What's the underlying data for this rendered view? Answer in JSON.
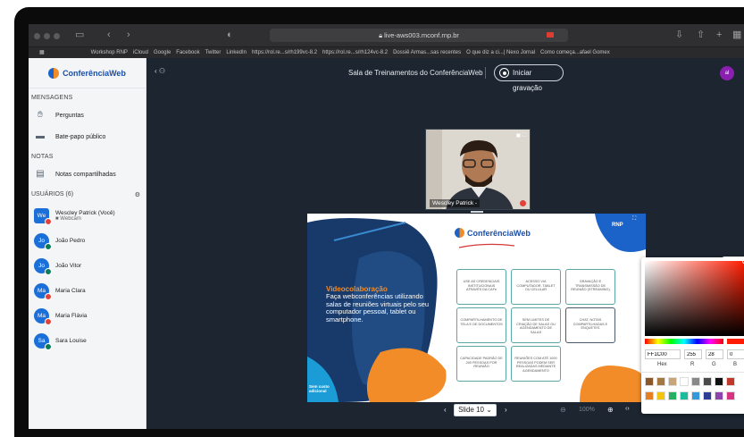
{
  "browser": {
    "url": "live-aws003.mconf.rnp.br",
    "bookmarks": [
      "Workshop RNP",
      "iCloud",
      "Google",
      "Facebook",
      "Twitter",
      "LinkedIn",
      "https://rol.re...s/rh199vc-8.2",
      "https://rol.re...s/rh124vc-8.2",
      "Dossiê Armas...sas recentes",
      "O que diz a ci...| Nexo Jornal",
      "Como começa...afael Gomex"
    ]
  },
  "sidebar": {
    "logo": "ConferênciaWeb",
    "messages_title": "MENSAGENS",
    "messages": [
      {
        "label": "Perguntas",
        "icon": "hand-icon"
      },
      {
        "label": "Bate-papo público",
        "icon": "chat-icon"
      }
    ],
    "notes_title": "NOTAS",
    "notes": [
      {
        "label": "Notas compartilhadas",
        "icon": "notes-icon"
      }
    ],
    "users_title": "USUÁRIOS (6)",
    "users": [
      {
        "initials": "We",
        "name": "Wescley Patrick (Você)",
        "sub": "Webcam",
        "color": "#1b6fd8",
        "self": true
      },
      {
        "initials": "Jo",
        "name": "João Pedro",
        "color": "#1b6fd8"
      },
      {
        "initials": "Jo",
        "name": "João Vitor",
        "color": "#1b6fd8"
      },
      {
        "initials": "Ma",
        "name": "Maria Clara",
        "color": "#1b6fd8"
      },
      {
        "initials": "Ma",
        "name": "Maria Flávia",
        "color": "#1b6fd8"
      },
      {
        "initials": "Sa",
        "name": "Sara Louise",
        "color": "#1b6fd8"
      }
    ]
  },
  "topbar": {
    "room_title": "Sala de Treinamentos do ConferênciaWeb",
    "record_label": "Iniciar gravação",
    "avatar_initials": "al"
  },
  "webcam": {
    "label": "Wescley Patrick"
  },
  "slide": {
    "logo": "ConferênciaWeb",
    "headline": "Videocolaboração",
    "body": "Faça webconferências utilizando salas de reuniões virtuais pelo seu computador pessoal, tablet ou smartphone.",
    "badge": "Sem custo adicional",
    "cards": [
      "USE AS CREDENCIAIS INSTITUCIONAIS ATRAVÉS DA CAFe",
      "ACESSO VIA COMPUTADOR, TABLET OU CELULAR",
      "GRAVAÇÃO E TRANSMISSÃO DE REUNIÃO (STREAMING)",
      "COMPARTILHAMENTO DE TELA E DE DOCUMENTOS",
      "SEM LIMITES DE CRIAÇÃO DE SALAS OU AGENDAMENTO DE SALAS",
      "CHAT, NOTAS COMPARTILHADAS E ENQUETES",
      "CAPACIDADE PADRÃO DE 200 PESSOAS POR REUNIÃO",
      "REUNIÕES COM ATÉ 1000 PESSOAS PODEM SER REALIZADAS MEDIANTE AGENDAMENTO"
    ],
    "rnp": "RNP"
  },
  "slide_controls": {
    "slide": "Slide 10",
    "zoom": "100%"
  },
  "picker": {
    "hex": "FF1C00",
    "r": "255",
    "g": "28",
    "b": "0",
    "hex_label": "Hex",
    "r_label": "R",
    "g_label": "G",
    "b_label": "B",
    "swatches": [
      "#8b572a",
      "#a57743",
      "#c8a47a",
      "#ffffff",
      "#888888",
      "#4a4a4a",
      "#111111",
      "#c0392b",
      "#e67e22",
      "#f1c40f",
      "#27ae60",
      "#1abc9c",
      "#3498db",
      "#2c3e95",
      "#8e44ad",
      "#d63384"
    ]
  }
}
